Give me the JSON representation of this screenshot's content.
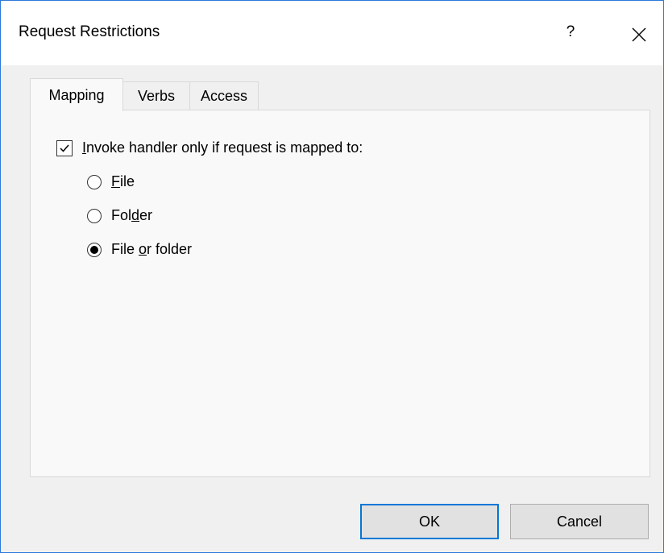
{
  "dialog": {
    "title": "Request Restrictions",
    "help_label": "?",
    "close_icon": "close-icon"
  },
  "tabs": [
    {
      "label": "Mapping",
      "active": true
    },
    {
      "label": "Verbs",
      "active": false
    },
    {
      "label": "Access",
      "active": false
    }
  ],
  "mapping": {
    "invoke_checkbox": {
      "pre": "",
      "mnemonic": "I",
      "post": "nvoke handler only if request is mapped to:",
      "checked": true
    },
    "options": [
      {
        "pre": "",
        "mnemonic": "F",
        "post": "ile",
        "checked": false
      },
      {
        "pre": "Fol",
        "mnemonic": "d",
        "post": "er",
        "checked": false
      },
      {
        "pre": "File ",
        "mnemonic": "o",
        "post": "r folder",
        "checked": true
      }
    ]
  },
  "buttons": {
    "ok_label": "OK",
    "cancel_label": "Cancel"
  },
  "colors": {
    "accent": "#0078d7",
    "window_border": "#2b79d8"
  }
}
